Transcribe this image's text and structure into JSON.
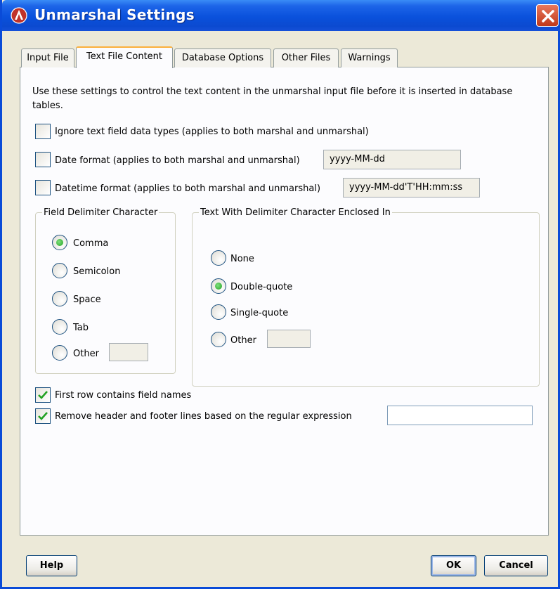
{
  "window": {
    "title": "Unmarshal Settings"
  },
  "tabs": [
    {
      "label": "Input File"
    },
    {
      "label": "Text File Content"
    },
    {
      "label": "Database Options"
    },
    {
      "label": "Other Files"
    },
    {
      "label": "Warnings"
    }
  ],
  "active_tab": "Text File Content",
  "description": "Use these settings to control the text content in the unmarshal input file before it is inserted in database tables.",
  "options": {
    "ignore_types": {
      "label": "Ignore text field data types (applies to both marshal and unmarshal)",
      "checked": false
    },
    "date_format": {
      "label": "Date format (applies to both marshal and unmarshal)",
      "checked": false,
      "value": "yyyy-MM-dd"
    },
    "datetime_format": {
      "label": "Datetime format (applies to both marshal and unmarshal)",
      "checked": false,
      "value": "yyyy-MM-dd'T'HH:mm:ss"
    }
  },
  "field_delimiter": {
    "title": "Field Delimiter Character",
    "options": [
      "Comma",
      "Semicolon",
      "Space",
      "Tab",
      "Other"
    ],
    "selected": "Comma",
    "other_value": ""
  },
  "enclosed_in": {
    "title": "Text With Delimiter Character Enclosed In",
    "options": [
      "None",
      "Double-quote",
      "Single-quote",
      "Other"
    ],
    "selected": "Double-quote",
    "other_value": ""
  },
  "first_row": {
    "label": "First row contains field names",
    "checked": true
  },
  "remove_header": {
    "label": "Remove header and footer lines based on the regular expression",
    "checked": true,
    "value": ""
  },
  "buttons": {
    "help": "Help",
    "ok": "OK",
    "cancel": "Cancel"
  },
  "colors": {
    "titlebar": "#0a51dc",
    "active_tab_accent": "#fbb03b",
    "radio_selected": "#21a121",
    "check_mark": "#21a121"
  }
}
